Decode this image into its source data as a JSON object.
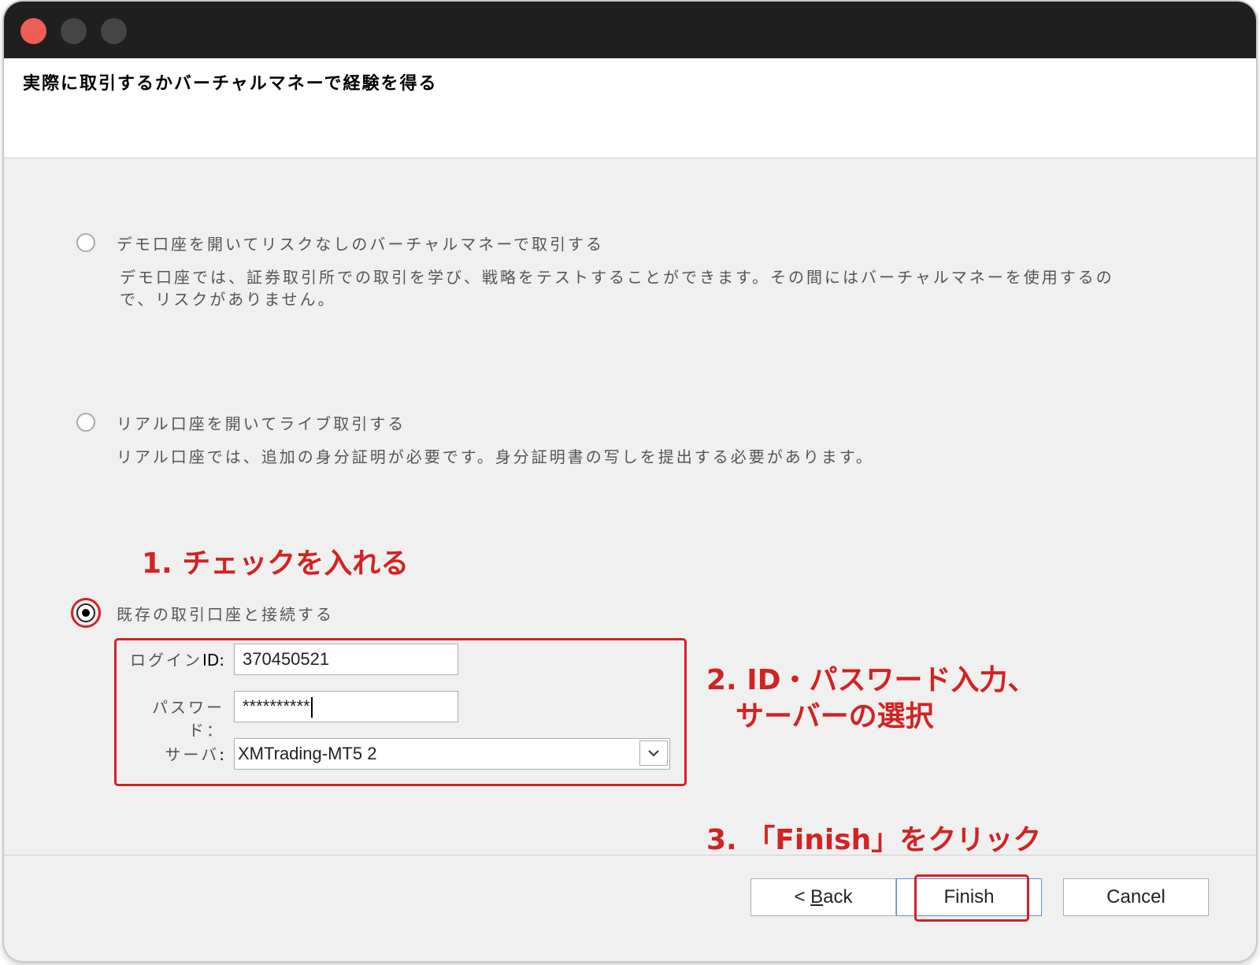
{
  "window": {
    "header_title": "実際に取引するかバーチャルマネーで経験を得る"
  },
  "options": [
    {
      "label": "デモ口座を開いてリスクなしのバーチャルマネーで取引する",
      "desc_line1": "デモ口座では、証券取引所での取引を学び、戦略をテストすることができます。その間にはバーチャルマネーを使用するの",
      "desc_line2": "で、リスクがありません。",
      "selected": false
    },
    {
      "label": "リアル口座を開いてライブ取引する",
      "desc_line1": "リアル口座では、追加の身分証明が必要です。身分証明書の写しを提出する必要があります。",
      "selected": false
    },
    {
      "label": "既存の取引口座と接続する",
      "selected": true
    }
  ],
  "form": {
    "login_label_jp": "ログイン",
    "login_label_ascii": "ID:",
    "login_value": "370450521",
    "password_label": "パスワード：",
    "password_value": "**********",
    "server_label_jp": "サーバ",
    "server_label_ascii": ":",
    "server_value": "XMTrading-MT5 2"
  },
  "annotations": {
    "step1": "1. チェックを入れる",
    "step2_line1": "2. ID・パスワード入力、",
    "step2_line2": "サーバーの選択",
    "step3": "3. 「Finish」をクリック"
  },
  "buttons": {
    "back_prefix": "< ",
    "back_mnemonic": "B",
    "back_rest": "ack",
    "finish": "Finish",
    "cancel": "Cancel"
  },
  "colors": {
    "annotation": "#d32222",
    "close_light": "#ee5d56"
  }
}
